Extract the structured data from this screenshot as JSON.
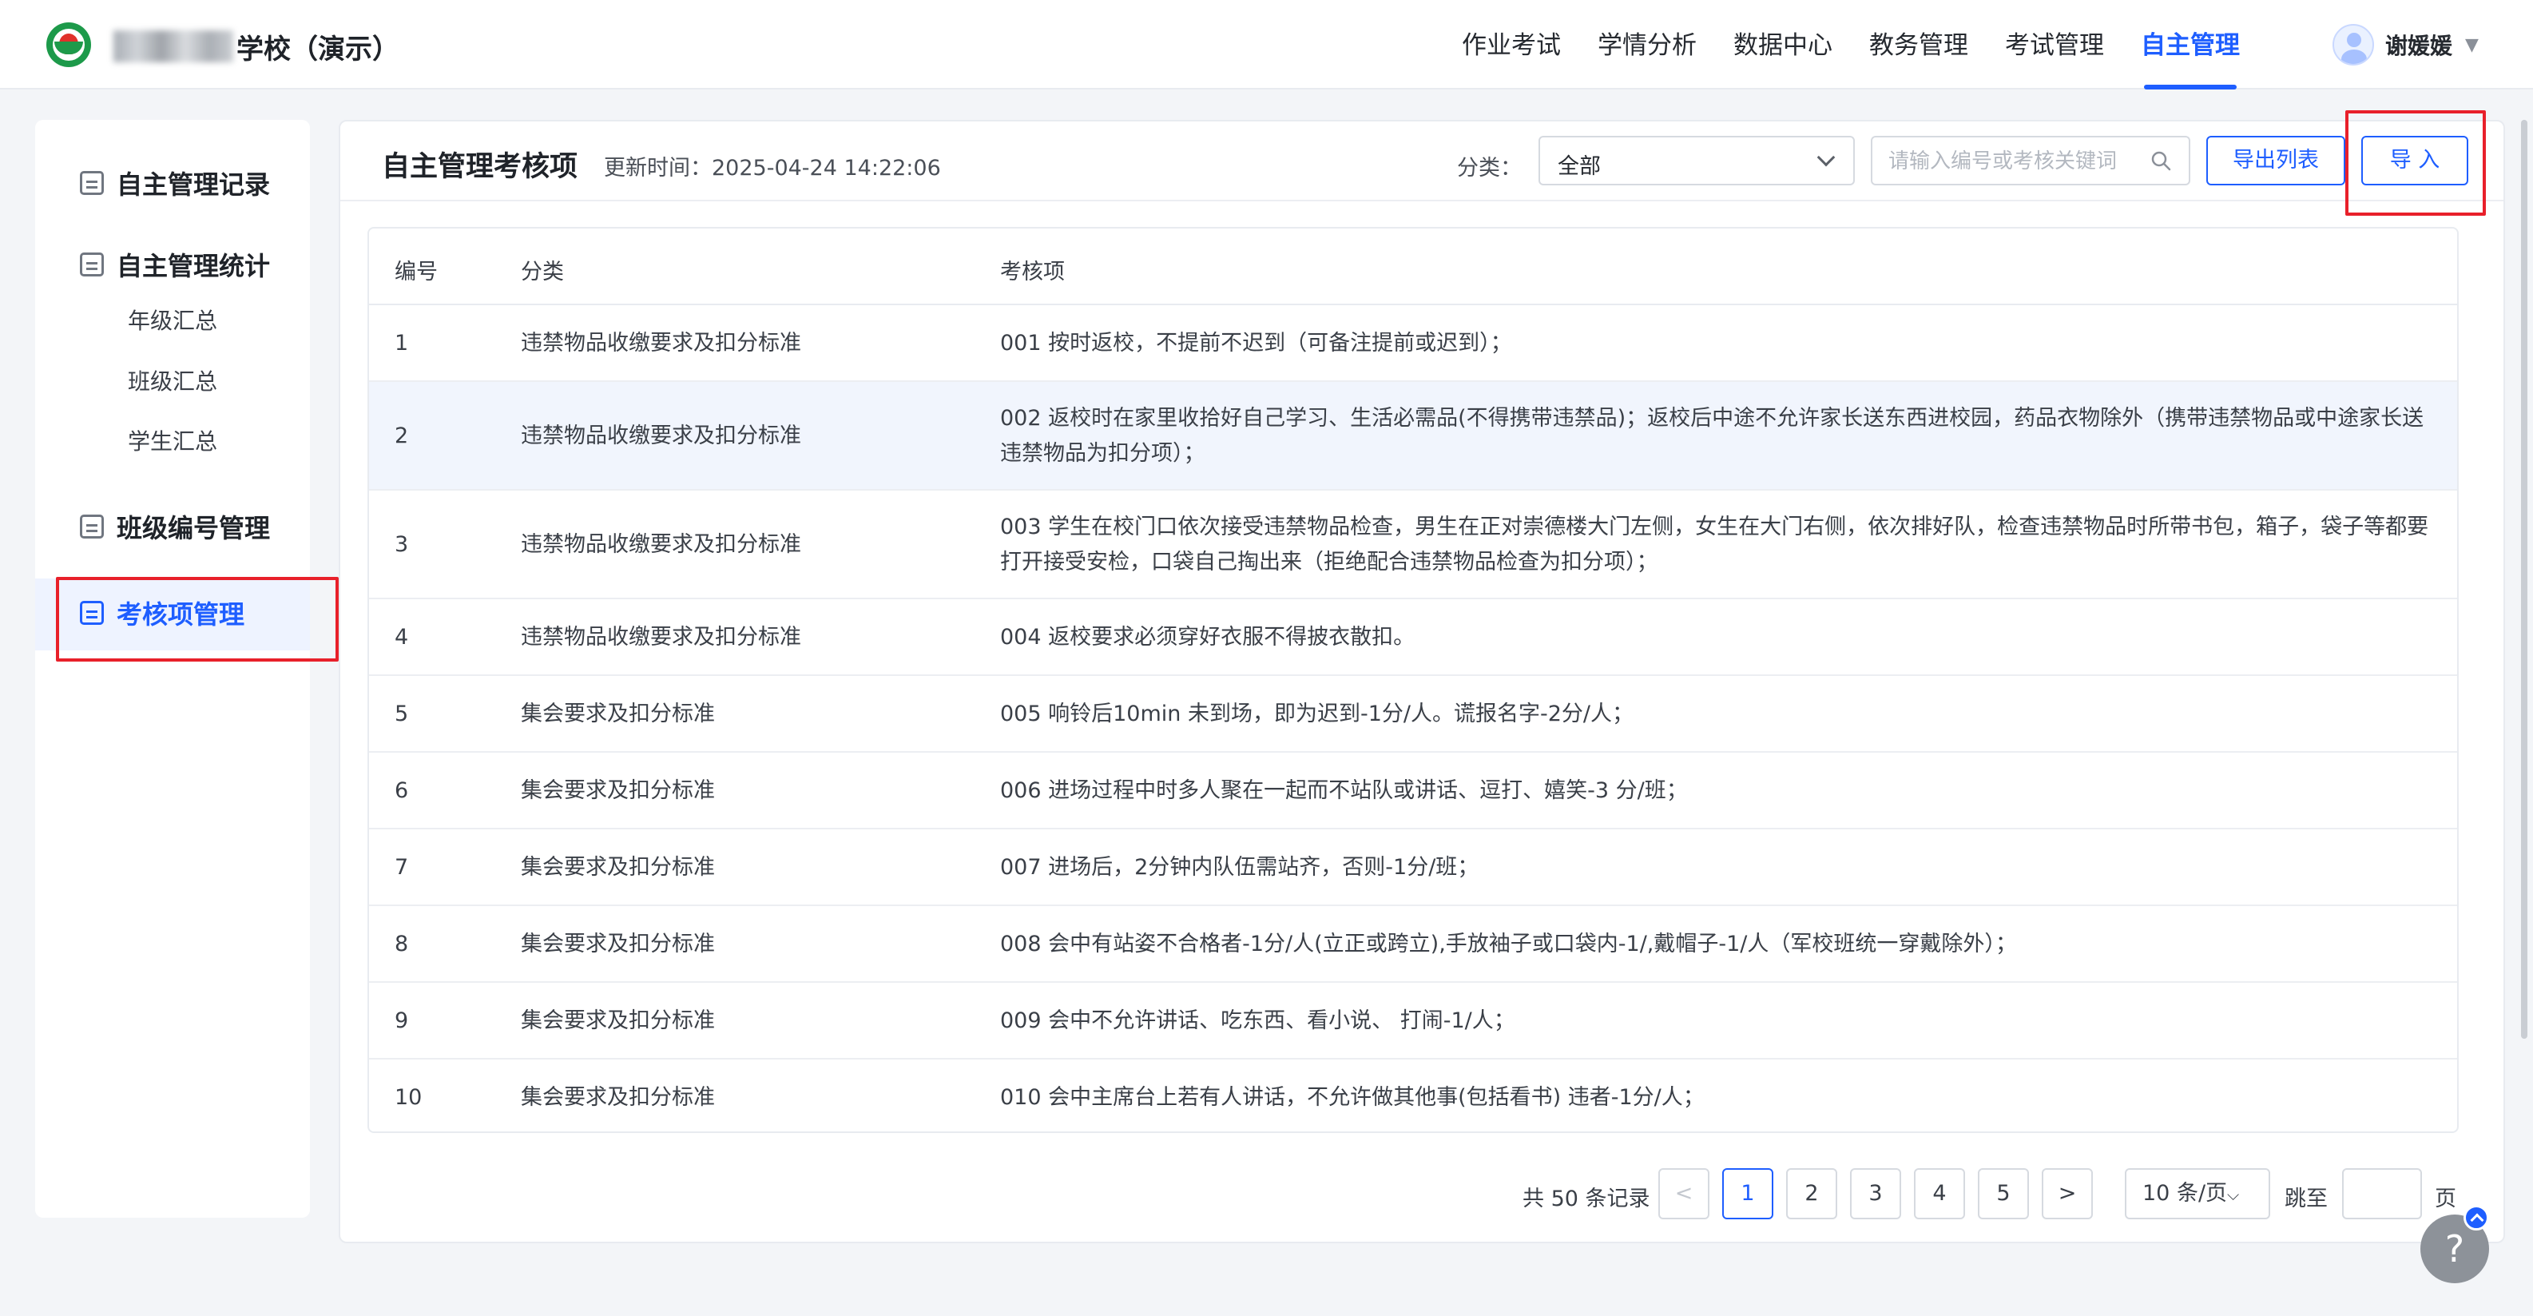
{
  "header": {
    "school_name": "学校（演示）",
    "nav": [
      "作业考试",
      "学情分析",
      "数据中心",
      "教务管理",
      "考试管理",
      "自主管理"
    ],
    "active_nav": "自主管理",
    "user_name": "谢媛媛",
    "user_caret": "▼"
  },
  "sidebar": {
    "record": "自主管理记录",
    "stats": "自主管理统计",
    "stats_sub": [
      "年级汇总",
      "班级汇总",
      "学生汇总"
    ],
    "class_no": "班级编号管理",
    "assessment": "考核项管理"
  },
  "toolbar": {
    "title": "自主管理考核项",
    "update_time": "更新时间：2025-04-24 14:22:06",
    "category_label": "分类：",
    "category_value": "全部",
    "search_placeholder": "请输入编号或考核关键词",
    "export_label": "导出列表",
    "import_label": "导 入"
  },
  "table": {
    "headers": [
      "编号",
      "分类",
      "考核项"
    ],
    "rows": [
      {
        "no": "1",
        "category": "违禁物品收缴要求及扣分标准",
        "item": "001 按时返校，不提前不迟到（可备注提前或迟到）；"
      },
      {
        "no": "2",
        "category": "违禁物品收缴要求及扣分标准",
        "item": "002 返校时在家里收拾好自己学习、生活必需品(不得携带违禁品)；返校后中途不允许家长送东西进校园，药品衣物除外（携带违禁物品或中途家长送违禁物品为扣分项）；"
      },
      {
        "no": "3",
        "category": "违禁物品收缴要求及扣分标准",
        "item": "003 学生在校门口依次接受违禁物品检查，男生在正对崇德楼大门左侧，女生在大门右侧，依次排好队，检查违禁物品时所带书包，箱子，袋子等都要打开接受安检，口袋自己掏出来（拒绝配合违禁物品检查为扣分项）；"
      },
      {
        "no": "4",
        "category": "违禁物品收缴要求及扣分标准",
        "item": "004 返校要求必须穿好衣服不得披衣散扣。"
      },
      {
        "no": "5",
        "category": "集会要求及扣分标准",
        "item": "005 响铃后10min 未到场，即为迟到-1分/人。谎报名字-2分/人；"
      },
      {
        "no": "6",
        "category": "集会要求及扣分标准",
        "item": "006 进场过程中时多人聚在一起而不站队或讲话、逗打、嬉笑-3 分/班；"
      },
      {
        "no": "7",
        "category": "集会要求及扣分标准",
        "item": "007 进场后，2分钟内队伍需站齐，否则-1分/班；"
      },
      {
        "no": "8",
        "category": "集会要求及扣分标准",
        "item": "008 会中有站姿不合格者-1分/人(立正或跨立),手放袖子或口袋内-1/,戴帽子-1/人（军校班统一穿戴除外）；"
      },
      {
        "no": "9",
        "category": "集会要求及扣分标准",
        "item": "009 会中不允许讲话、吃东西、看小说、 打闹-1/人；"
      },
      {
        "no": "10",
        "category": "集会要求及扣分标准",
        "item": "010 会中主席台上若有人讲话，不允许做其他事(包括看书) 违者-1分/人；"
      }
    ],
    "highlight_row": "2"
  },
  "pagination": {
    "total": "共 50 条记录",
    "prev": "<",
    "pages": [
      "1",
      "2",
      "3",
      "4",
      "5"
    ],
    "current": "1",
    "next": ">",
    "page_size": "10 条/页",
    "goto_label": "跳至",
    "page_suffix": "页"
  },
  "help": {
    "label": "?"
  },
  "colors": {
    "accent": "#1e5eff",
    "annotation_red": "#e8202a",
    "logo_green": "#1d9a4a"
  }
}
